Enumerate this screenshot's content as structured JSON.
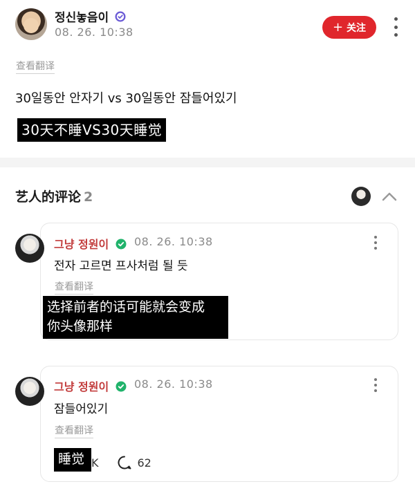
{
  "post": {
    "author": "정신놓음이",
    "time": "08. 26. 10:38",
    "follow_label": "关注",
    "translate_label": "查看翻译",
    "text": "30일동안 안자기 vs 30일동안 잠들어있기",
    "translation": "30天不睡VS30天睡觉"
  },
  "comments_section": {
    "title": "艺人的评论",
    "count": "2"
  },
  "comments": [
    {
      "name": "그냥 정원이",
      "time": "08. 26. 10:38",
      "text": "전자 고르면 프사처럼 될 듯",
      "translate_label": "查看翻译",
      "translation_line1": "选择前者的话可能就会变成",
      "translation_line2": "你头像那样"
    },
    {
      "name": "그냥 정원이",
      "time": "08. 26. 10:38",
      "text": "잠들어있기",
      "translate_label": "查看翻译",
      "translation": "睡觉",
      "likes_visible": "K",
      "replies": "62"
    }
  ],
  "colors": {
    "accent_red": "#e0262c",
    "artist_name": "#c23b3b",
    "verified_purple": "#6b5bd6",
    "verified_green": "#20b36b"
  }
}
